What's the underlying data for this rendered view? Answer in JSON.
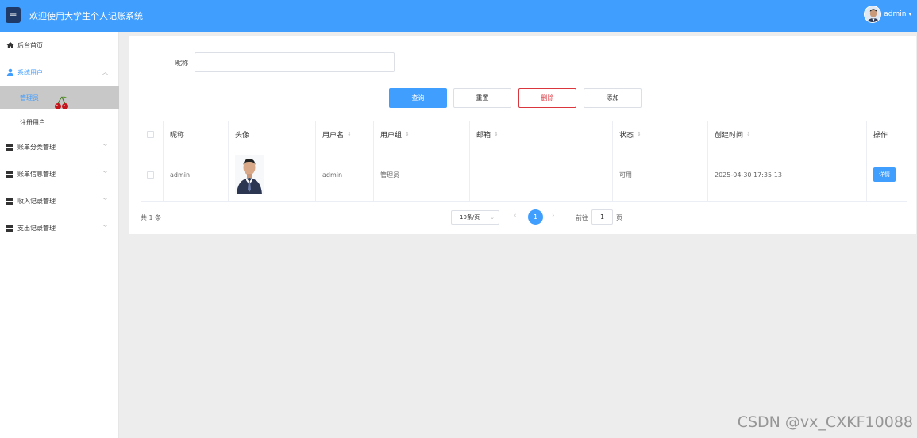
{
  "header": {
    "title": "欢迎使用大学生个人记账系统",
    "username": "admin",
    "menu_icon": "hamburger-icon",
    "brand_color": "#409eff"
  },
  "sidebar": {
    "items": [
      {
        "label": "后台首页",
        "icon": "home-icon"
      },
      {
        "label": "系统用户",
        "icon": "user-icon",
        "expanded": true
      },
      {
        "label": "管理员",
        "selected": true
      },
      {
        "label": "注册用户"
      },
      {
        "label": "账单分类管理",
        "icon": "grid-icon"
      },
      {
        "label": "账单信息管理",
        "icon": "grid-icon"
      },
      {
        "label": "收入记录管理",
        "icon": "grid-icon"
      },
      {
        "label": "支出记录管理",
        "icon": "grid-icon"
      }
    ]
  },
  "search": {
    "label": "昵称",
    "value": "",
    "placeholder": ""
  },
  "actions": {
    "query": "查询",
    "reset": "重置",
    "delete": "删除",
    "add": "添加"
  },
  "table": {
    "headers": [
      "昵称",
      "头像",
      "用户名",
      "用户组",
      "邮箱",
      "状态",
      "创建时间",
      "操作"
    ],
    "rows": [
      {
        "nickname": "admin",
        "username": "admin",
        "group": "管理员",
        "email": "",
        "status": "可用",
        "created": "2025-04-30 17:35:13",
        "action": "详情"
      }
    ]
  },
  "pagination": {
    "total": "共 1 条",
    "page_size": "10条/页",
    "current_page": "1",
    "goto_label": "前往",
    "goto_value": "1",
    "goto_suffix": "页"
  },
  "watermark": "CSDN @vx_CXKF10088"
}
